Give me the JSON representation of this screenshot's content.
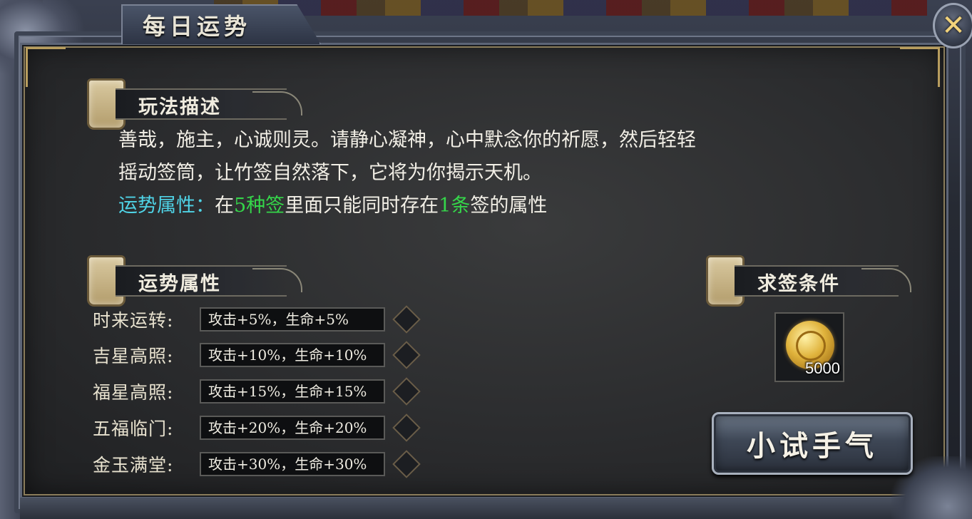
{
  "window": {
    "title": "每日运势",
    "close_symbol": "✕"
  },
  "description_section": {
    "header": "玩法描述",
    "line1": "善哉，施主，心诚则灵。请静心凝神，心中默念你的祈愿，然后轻轻",
    "line2": "摇动签筒，让竹签自然落下，它将为你揭示天机。",
    "line3": {
      "label": "运势属性：",
      "text_a": "在",
      "highlight_a": "5种签",
      "text_b": "里面只能同时存在",
      "highlight_b": "1条",
      "text_c": "签的属性"
    }
  },
  "attributes_section": {
    "header": "运势属性",
    "rows": [
      {
        "name": "时来运转:",
        "value": "攻击+5%，生命+5%"
      },
      {
        "name": "吉星高照:",
        "value": "攻击+10%，生命+10%"
      },
      {
        "name": "福星高照:",
        "value": "攻击+15%，生命+15%"
      },
      {
        "name": "五福临门:",
        "value": "攻击+20%，生命+20%"
      },
      {
        "name": "金玉满堂:",
        "value": "攻击+30%，生命+30%"
      }
    ]
  },
  "cost_section": {
    "header": "求签条件",
    "item_icon": "gold-coin-icon",
    "amount": "5000"
  },
  "action": {
    "label": "小试手气"
  },
  "colors": {
    "highlight_cyan": "#4fd3e6",
    "highlight_green": "#35d64a",
    "close_x": "#f2d27a"
  }
}
